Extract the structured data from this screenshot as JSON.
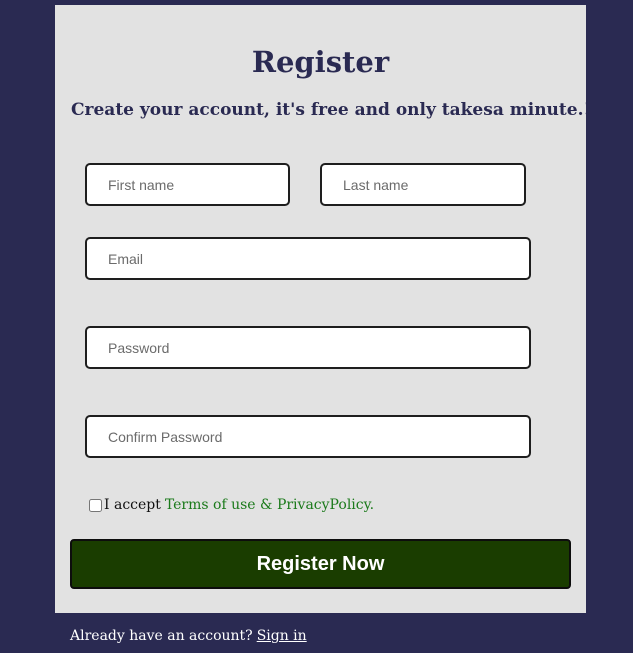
{
  "form": {
    "title": "Register",
    "subtitle": "Create your account, it's free and only takesa minute.!",
    "fields": {
      "first_name": {
        "placeholder": "First name",
        "value": ""
      },
      "last_name": {
        "placeholder": "Last name",
        "value": ""
      },
      "email": {
        "placeholder": "Email",
        "value": ""
      },
      "password": {
        "placeholder": "Password",
        "value": ""
      },
      "confirm_password": {
        "placeholder": "Confirm Password",
        "value": ""
      }
    },
    "terms": {
      "prefix": "I accept",
      "link_label": "Terms of use & PrivacyPolicy.",
      "checked": false
    },
    "submit_label": "Register Now"
  },
  "footer": {
    "prompt": "Already have an account?",
    "signin_label": "Sign in"
  },
  "colors": {
    "background": "#2a2a52",
    "card": "#e2e2e2",
    "button": "#1a3d00",
    "link_green": "#1b7a1b"
  }
}
